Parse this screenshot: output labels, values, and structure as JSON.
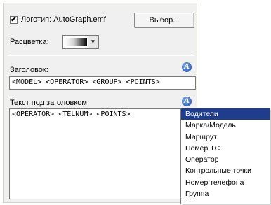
{
  "logo": {
    "label": "Логотип: AutoGraph.emf",
    "checked": true,
    "button_label": "Выбор..."
  },
  "color_scheme": {
    "label": "Расцветка:"
  },
  "header": {
    "label": "Заголовок:",
    "value": "<MODEL> <OPERATOR> <GROUP> <POINTS>"
  },
  "subtitle": {
    "label": "Текст под заголовком:",
    "value": "<OPERATOR> <TELNUM> <POINTS>"
  },
  "menu": {
    "items": [
      "Водители",
      "Марка/Модель",
      "Маршрут",
      "Номер ТС",
      "Оператор",
      "Контрольные точки",
      "Номер телефона",
      "Группа"
    ],
    "selected_index": 0,
    "selected_color": "#1f3d8c"
  }
}
